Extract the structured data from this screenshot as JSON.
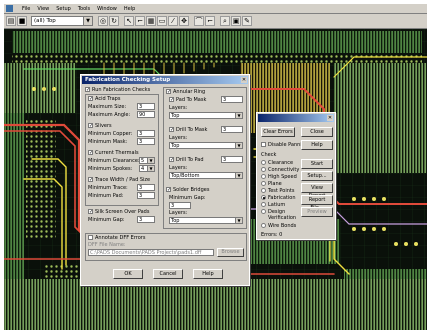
{
  "menu": {
    "items": [
      "File",
      "View",
      "Setup",
      "Tools",
      "Window",
      "Help"
    ]
  },
  "toolbar": {
    "layer_value": "(all) Top"
  },
  "fab": {
    "title": "Fabrication Checking Setup",
    "run_checks": "Run Fabrication Checks",
    "acid_traps": "Acid Traps",
    "max_size": "Maximum Size:",
    "max_size_val": "3",
    "max_angle": "Maximum Angle:",
    "max_angle_val": "90",
    "slivers": "Slivers",
    "min_copper": "Minimum Copper:",
    "min_copper_val": "3",
    "min_mask": "Minimum Mask:",
    "min_mask_val": "3",
    "current_thermals": "Current Thermals",
    "min_clearance": "Minimum Clearance:",
    "min_clearance_val": "5",
    "min_spokes": "Minimum Spokes:",
    "min_spokes_val": "4",
    "trace_width": "Trace Width / Pad Size",
    "min_trace": "Minimum Trace:",
    "min_trace_val": "3",
    "min_pad": "Minimum Pad:",
    "min_pad_val": "3",
    "silk_screen": "Silk Screen Over Pads",
    "min_gap": "Minimum Gap:",
    "min_gap_val": "3",
    "annular_ring": "Annular Ring",
    "pad_to_mask": "Pad To Mask",
    "pad_to_mask_val": "3",
    "layers": "Layers:",
    "layer_top": "Top",
    "drill_to_mask": "Drill To Mask",
    "drill_to_mask_val": "3",
    "drill_to_pad": "Drill To Pad",
    "drill_to_pad_val": "3",
    "layer_pad": "Top/Bottom",
    "solder_bridges": "Solder Bridges",
    "bridges_min_gap": "Minimum Gap:",
    "bridges_min_gap_val": "3",
    "annotate": "Annotate DFF Errors",
    "dff_file": "DFF File Name:",
    "dff_path": "C:\\PADS Documents\\PADS Projects\\pads1.dff",
    "browse": "Browse",
    "ok": "OK",
    "cancel": "Cancel",
    "help": "Help"
  },
  "verify": {
    "clear_errors": "Clear Errors",
    "close": "Close",
    "disable_panning": "Disable Panning",
    "help": "Help",
    "check": "Check",
    "options": [
      "Clearance",
      "Connectivity",
      "High Speed",
      "Plane",
      "Test Points",
      "Fabrication",
      "Latium",
      "Design Verification",
      "Wire Bonds"
    ],
    "selected": "Fabrication",
    "start": "Start",
    "setup": "Setup...",
    "view_report": "View Report",
    "report_file": "Report File...",
    "preview": "Preview",
    "errors": "Errors: 0"
  }
}
